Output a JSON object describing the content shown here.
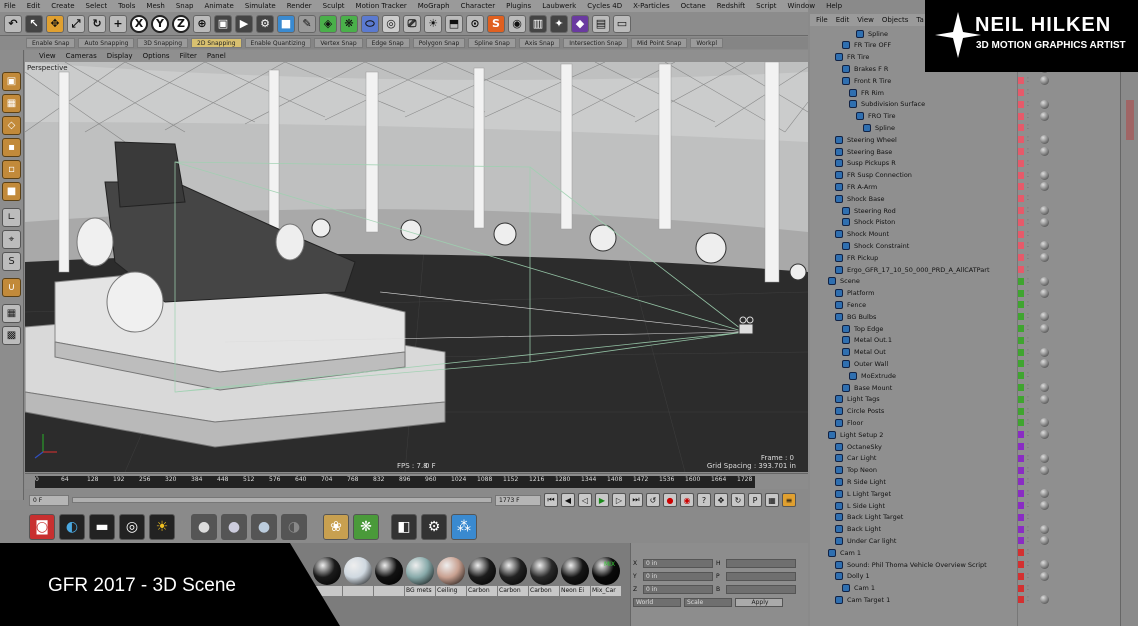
{
  "menubar": [
    "File",
    "Edit",
    "Create",
    "Select",
    "Tools",
    "Mesh",
    "Snap",
    "Animate",
    "Simulate",
    "Render",
    "Sculpt",
    "Motion Tracker",
    "MoGraph",
    "Character",
    "Plugins",
    "Laubwerk",
    "Cycles 4D",
    "X-Particles",
    "Octane",
    "Redshift",
    "Script",
    "Window",
    "Help"
  ],
  "toolbar": {
    "axis_x": "X",
    "axis_y": "Y",
    "axis_z": "Z"
  },
  "snapbar": [
    "Enable Snap",
    "Auto Snapping",
    "3D Snapping",
    "2D Snapping",
    "Enable Quantizing",
    "Vertex Snap",
    "Edge Snap",
    "Polygon Snap",
    "Spline Snap",
    "Axis Snap",
    "Intersection Snap",
    "Mid Point Snap",
    "Workpl"
  ],
  "viewport_menu": [
    "View",
    "Cameras",
    "Display",
    "Options",
    "Filter",
    "Panel"
  ],
  "viewport": {
    "persp": "Perspective",
    "fps": "FPS : 7.8",
    "frame_center": "0 F",
    "frame": "Frame : 0",
    "grid": "Grid Spacing : 393.701 in"
  },
  "timeline_ticks": [
    "0",
    "64",
    "128",
    "192",
    "256",
    "320",
    "384",
    "448",
    "512",
    "576",
    "640",
    "704",
    "768",
    "832",
    "896",
    "960",
    "1024",
    "1088",
    "1152",
    "1216",
    "1280",
    "1344",
    "1408",
    "1472",
    "1536",
    "1600",
    "1664",
    "1728"
  ],
  "playbar": {
    "start": "0 F",
    "current": "1773 F",
    "end": "1773 F"
  },
  "materials": [
    {
      "label": "",
      "color": "#1a1a1a"
    },
    {
      "label": "",
      "color": "#cfd8e0"
    },
    {
      "label": "",
      "color": "#111111"
    },
    {
      "label": "BG mets",
      "color": "#8aa"
    },
    {
      "label": "Ceiling",
      "color": "#c8a090"
    },
    {
      "label": "Carbon",
      "color": "#1c1c1c"
    },
    {
      "label": "Carbon",
      "color": "#222222"
    },
    {
      "label": "Carbon",
      "color": "#2a2a2a"
    },
    {
      "label": "Neon Ei",
      "color": "#151515"
    },
    {
      "label": "Mix_Car",
      "color": "#0a0a0a"
    }
  ],
  "mix_label": "MIX",
  "coords": {
    "x": "X",
    "y": "Y",
    "z": "Z",
    "v1": "0 in",
    "v2": "0 in",
    "v3": "0 in",
    "h": "H",
    "p": "P",
    "b": "B",
    "world": "World",
    "scale": "Scale",
    "apply": "Apply"
  },
  "caption": "GFR 2017 - 3D Scene",
  "brand": {
    "name": "NEIL HILKEN",
    "sub": "3D MOTION GRAPHICS ARTIST"
  },
  "objects_menu": [
    "File",
    "Edit",
    "View",
    "Objects",
    "Ta"
  ],
  "objects": [
    {
      "name": "Spline",
      "indent": 4,
      "vis": "#e65a6a"
    },
    {
      "name": "FR Tire OFF",
      "indent": 2,
      "vis": "#e65a6a"
    },
    {
      "name": "FR Tire",
      "indent": 1,
      "vis": "#e65a6a"
    },
    {
      "name": "Brakes F R",
      "indent": 2,
      "vis": "#e65a6a"
    },
    {
      "name": "Front R Tire",
      "indent": 2,
      "vis": "#e65a6a"
    },
    {
      "name": "FR Rim",
      "indent": 3,
      "vis": "#e65a6a"
    },
    {
      "name": "Subdivision Surface",
      "indent": 3,
      "vis": "#e65a6a"
    },
    {
      "name": "FRO Tire",
      "indent": 4,
      "vis": "#e65a6a"
    },
    {
      "name": "Spline",
      "indent": 5,
      "vis": "#e65a6a"
    },
    {
      "name": "Steering Wheel",
      "indent": 1,
      "vis": "#e65a6a"
    },
    {
      "name": "Steering Base",
      "indent": 1,
      "vis": "#e65a6a"
    },
    {
      "name": "Susp Pickups R",
      "indent": 1,
      "vis": "#e65a6a"
    },
    {
      "name": "FR Susp Connection",
      "indent": 1,
      "vis": "#e65a6a"
    },
    {
      "name": "FR A-Arm",
      "indent": 1,
      "vis": "#e65a6a"
    },
    {
      "name": "Shock Base",
      "indent": 1,
      "vis": "#e65a6a"
    },
    {
      "name": "Steering Rod",
      "indent": 2,
      "vis": "#e65a6a"
    },
    {
      "name": "Shock Piston",
      "indent": 2,
      "vis": "#e65a6a"
    },
    {
      "name": "Shock Mount",
      "indent": 1,
      "vis": "#e65a6a"
    },
    {
      "name": "Shock Constraint",
      "indent": 2,
      "vis": "#e65a6a"
    },
    {
      "name": "FR Pickup",
      "indent": 1,
      "vis": "#e65a6a"
    },
    {
      "name": "Ergo_GFR_17_10_50_000_PRD_A_AllCATPart",
      "indent": 1,
      "vis": "#e65a6a"
    },
    {
      "name": "Scene",
      "indent": 0,
      "vis": "#3fa52f"
    },
    {
      "name": "Platform",
      "indent": 1,
      "vis": "#3fa52f"
    },
    {
      "name": "Fence",
      "indent": 1,
      "vis": "#3fa52f"
    },
    {
      "name": "BG Bulbs",
      "indent": 1,
      "vis": "#3fa52f"
    },
    {
      "name": "Top Edge",
      "indent": 2,
      "vis": "#3fa52f"
    },
    {
      "name": "Metal Out.1",
      "indent": 2,
      "vis": "#3fa52f"
    },
    {
      "name": "Metal Out",
      "indent": 2,
      "vis": "#3fa52f"
    },
    {
      "name": "Outer Wall",
      "indent": 2,
      "vis": "#3fa52f"
    },
    {
      "name": "MoExtrude",
      "indent": 3,
      "vis": "#3fa52f"
    },
    {
      "name": "Base Mount",
      "indent": 2,
      "vis": "#3fa52f"
    },
    {
      "name": "Light Tags",
      "indent": 1,
      "vis": "#3fa52f"
    },
    {
      "name": "Circle Posts",
      "indent": 1,
      "vis": "#3fa52f"
    },
    {
      "name": "Floor",
      "indent": 1,
      "vis": "#3fa52f"
    },
    {
      "name": "Light Setup 2",
      "indent": 0,
      "vis": "#8a2cc4"
    },
    {
      "name": "OctaneSky",
      "indent": 1,
      "vis": "#8a2cc4"
    },
    {
      "name": "Car Light",
      "indent": 1,
      "vis": "#8a2cc4"
    },
    {
      "name": "Top Neon",
      "indent": 1,
      "vis": "#8a2cc4"
    },
    {
      "name": "R Side Light",
      "indent": 1,
      "vis": "#8a2cc4"
    },
    {
      "name": "L Light Target",
      "indent": 1,
      "vis": "#8a2cc4"
    },
    {
      "name": "L Side Light",
      "indent": 1,
      "vis": "#8a2cc4"
    },
    {
      "name": "Back Light Target",
      "indent": 1,
      "vis": "#8a2cc4"
    },
    {
      "name": "Back Light",
      "indent": 1,
      "vis": "#8a2cc4"
    },
    {
      "name": "Under Car light",
      "indent": 1,
      "vis": "#8a2cc4"
    },
    {
      "name": "Cam 1",
      "indent": 0,
      "vis": "#d43030"
    },
    {
      "name": "Sound: Phil Thoma Vehicle Overview Script",
      "indent": 1,
      "vis": "#d43030"
    },
    {
      "name": "Dolly 1",
      "indent": 1,
      "vis": "#d43030"
    },
    {
      "name": "Cam 1",
      "indent": 2,
      "vis": "#d43030"
    },
    {
      "name": "Cam Target 1",
      "indent": 1,
      "vis": "#d43030"
    }
  ],
  "colors": {
    "accent_snap": "#d8c070",
    "scene_green": "#3fa52f",
    "light_purple": "#8a2cc4",
    "cam_red": "#d43030"
  }
}
